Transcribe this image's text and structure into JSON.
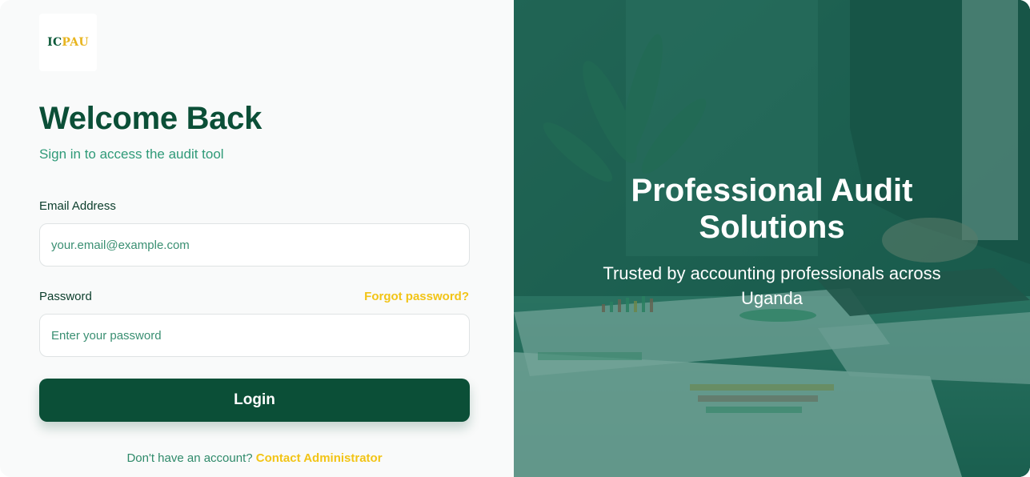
{
  "logo": {
    "ic": "IC",
    "pau": "PAU"
  },
  "login": {
    "title": "Welcome Back",
    "subtitle": "Sign in to access the audit tool",
    "email_label": "Email Address",
    "email_placeholder": "your.email@example.com",
    "password_label": "Password",
    "forgot_label": "Forgot password?",
    "password_placeholder": "Enter your password",
    "login_button": "Login",
    "signup_prompt": "Don't have an account?",
    "signup_link": "Contact Administrator"
  },
  "hero": {
    "title": "Professional Audit Solutions",
    "subtitle": "Trusted by accounting professionals across Uganda"
  },
  "colors": {
    "brand_green": "#0b4f37",
    "accent_yellow": "#f2c416",
    "muted_green": "#2f9a78"
  }
}
